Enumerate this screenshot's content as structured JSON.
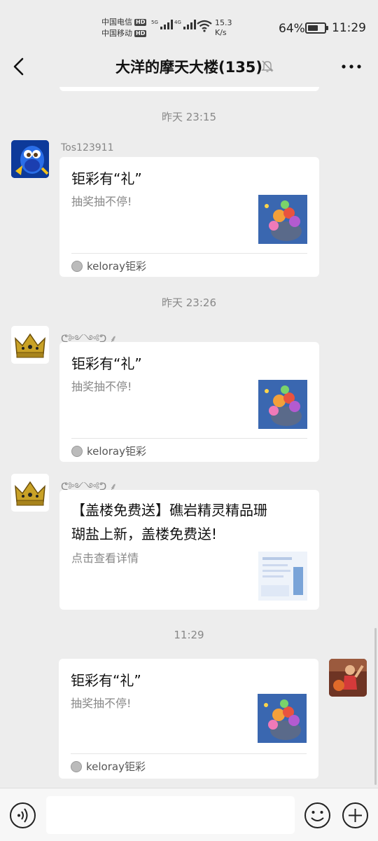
{
  "status_bar": {
    "carrier1": "中国电信",
    "carrier2": "中国移动",
    "hd_badge": "HD",
    "net1": "5G",
    "net2": "4G",
    "speed_value": "15.3",
    "speed_unit": "K/s",
    "battery_pct": "64%",
    "battery_level": 0.64,
    "time": "11:29"
  },
  "header": {
    "title": "大洋的摩天大楼(135)"
  },
  "messages": [
    {
      "timestamp": "昨天 23:15",
      "sender": "Tos123911",
      "card_title": "钜彩有“礼”",
      "card_desc": "抽奖抽不停!",
      "source": "keloray钜彩"
    },
    {
      "timestamp": "昨天 23:26",
      "sender": "ᕦ༻༺ᕤ ⸙",
      "card_title": "钜彩有“礼”",
      "card_desc": "抽奖抽不停!",
      "source": "keloray钜彩"
    },
    {
      "sender": "ᕦ༻༺ᕤ ⸙",
      "card_title_line1": "【盖楼免费送】礁岩精灵精品珊",
      "card_title_line2": "瑚盐上新，盖楼免费送!",
      "card_desc": "点击查看详情"
    },
    {
      "timestamp": "11:29",
      "card_title": "钜彩有“礼”",
      "card_desc": "抽奖抽不停!",
      "source": "keloray钜彩"
    }
  ],
  "input": {
    "value": ""
  }
}
